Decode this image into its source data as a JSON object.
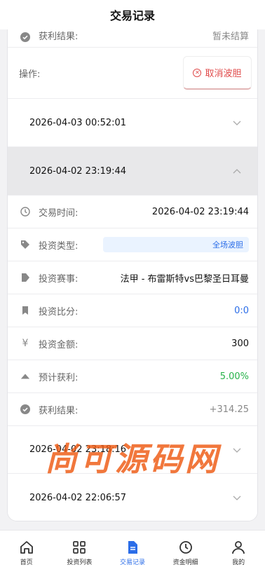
{
  "header": {
    "title": "交易记录"
  },
  "top_partial": {
    "label": "获利结果:",
    "value": "暂未结算"
  },
  "action_row": {
    "label": "操作:",
    "button": "取消波胆"
  },
  "records": [
    {
      "datetime": "2026-04-03 00:52:01",
      "expanded": false
    },
    {
      "datetime": "2026-04-02 23:19:44",
      "expanded": true
    },
    {
      "datetime": "2026-04-02 23:18:16",
      "expanded": false
    },
    {
      "datetime": "2026-04-02 22:06:57",
      "expanded": false
    }
  ],
  "detail": {
    "time_label": "交易时间:",
    "time_value": "2026-04-02 23:19:44",
    "type_label": "投资类型:",
    "type_value": "全场波胆",
    "event_label": "投资赛事:",
    "event_value": "法甲 - 布雷斯特vs巴黎圣日耳曼",
    "score_label": "投资比分:",
    "score_value": "0:0",
    "amount_label": "投资金额:",
    "amount_value": "300",
    "profit_rate_label": "预计获利:",
    "profit_rate_value": "5.00%",
    "result_label": "获利结果:",
    "result_value": "+314.25"
  },
  "watermark": "尚可源码网",
  "tabs": [
    {
      "label": "首页",
      "icon": "home-icon"
    },
    {
      "label": "投资列表",
      "icon": "grid-icon"
    },
    {
      "label": "交易记录",
      "icon": "document-icon",
      "active": true
    },
    {
      "label": "资金明细",
      "icon": "clock-icon"
    },
    {
      "label": "我的",
      "icon": "user-icon"
    }
  ],
  "colors": {
    "accent": "#2b6de8",
    "danger": "#e04a4a",
    "success": "#27b24a",
    "header_bg": "#e8e8ea"
  }
}
